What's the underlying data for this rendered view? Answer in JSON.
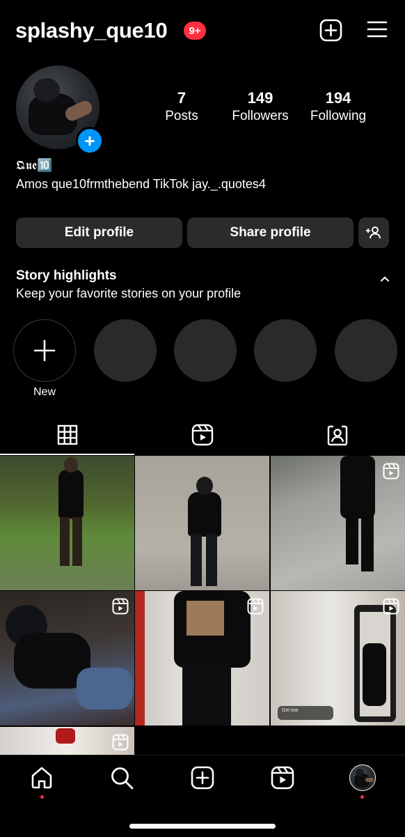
{
  "header": {
    "username": "splashy_que10",
    "notification_badge": "9+",
    "icons": [
      "add-post-icon",
      "menu-icon"
    ]
  },
  "profile": {
    "stats": [
      {
        "value": "7",
        "label": "Posts"
      },
      {
        "value": "149",
        "label": "Followers"
      },
      {
        "value": "194",
        "label": "Following"
      }
    ],
    "display_name": "𝕼𝖚𝖊🔟",
    "bio": "Amos que10frmthebend TikTok jay._.quotes4"
  },
  "actions": {
    "edit_profile": "Edit profile",
    "share_profile": "Share profile"
  },
  "highlights": {
    "title": "Story highlights",
    "subtitle": "Keep your favorite stories on your profile",
    "new_label": "New",
    "placeholder_count": 4
  },
  "tabs": [
    "grid-icon",
    "reels-icon",
    "tagged-icon"
  ],
  "grid": [
    {
      "type": "photo"
    },
    {
      "type": "photo"
    },
    {
      "type": "reel"
    },
    {
      "type": "reel"
    },
    {
      "type": "reel"
    },
    {
      "type": "reel",
      "overlay_text": "Get low"
    },
    {
      "type": "reel"
    }
  ],
  "colors": {
    "badge": "#ff3040",
    "accent_blue": "#0095f6",
    "button_bg": "#2b2b2b",
    "background": "#000000"
  },
  "bottom_nav": [
    "home-icon",
    "search-icon",
    "create-icon",
    "reels-icon",
    "profile-avatar"
  ]
}
